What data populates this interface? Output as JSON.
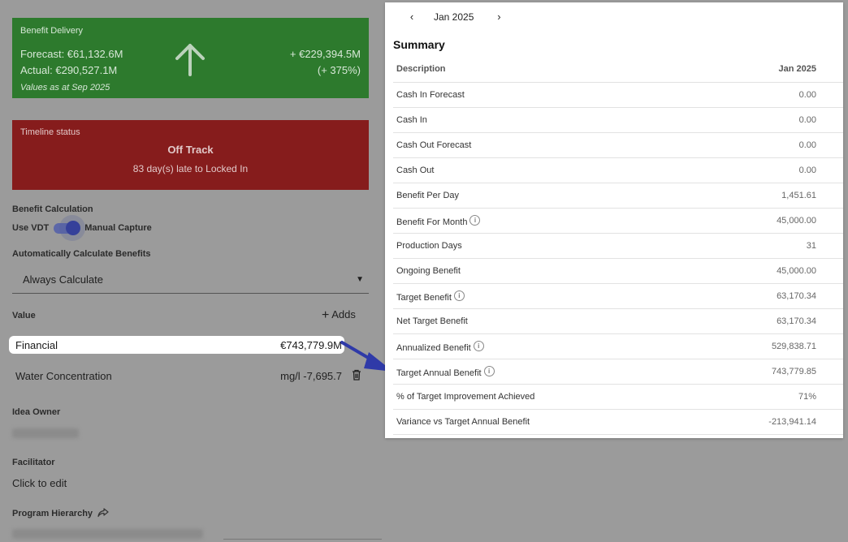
{
  "benefit_delivery": {
    "title": "Benefit Delivery",
    "forecast": "Forecast: €61,132.6M",
    "actual": "Actual: €290,527.1M",
    "as_of": "Values as at Sep 2025",
    "delta": "+ €229,394.5M",
    "delta_pct": "(+ 375%)",
    "trend_icon": "arrow-up-icon",
    "color": "#2d7a2d"
  },
  "timeline": {
    "title": "Timeline status",
    "status": "Off Track",
    "detail": "83 day(s) late to Locked In",
    "color": "#861c1c"
  },
  "calculation": {
    "label": "Benefit Calculation",
    "toggle_left": "Use VDT",
    "toggle_right": "Manual Capture",
    "toggle_on": true,
    "auto_label": "Automatically Calculate Benefits",
    "auto_value": "Always Calculate"
  },
  "value": {
    "label": "Value",
    "add_label": "Adds",
    "rows": [
      {
        "name": "Financial",
        "value": "€743,779.9M"
      },
      {
        "name": "Water Concentration",
        "value": "mg/l -7,695.7"
      }
    ]
  },
  "idea_owner": {
    "label": "Idea Owner"
  },
  "facilitator": {
    "label": "Facilitator",
    "value": "Click to edit"
  },
  "program_hierarchy": {
    "label": "Program Hierarchy"
  },
  "summary": {
    "month": "Jan 2025",
    "title": "Summary",
    "columns": [
      "Description",
      "Jan 2025"
    ],
    "rows": [
      {
        "desc": "Cash In Forecast",
        "value": "0.00",
        "info": false
      },
      {
        "desc": "Cash In",
        "value": "0.00",
        "info": false
      },
      {
        "desc": "Cash Out Forecast",
        "value": "0.00",
        "info": false
      },
      {
        "desc": "Cash Out",
        "value": "0.00",
        "info": false
      },
      {
        "desc": "Benefit Per Day",
        "value": "1,451.61",
        "info": false
      },
      {
        "desc": "Benefit For Month",
        "value": "45,000.00",
        "info": true
      },
      {
        "desc": "Production Days",
        "value": "31",
        "info": false
      },
      {
        "desc": "Ongoing Benefit",
        "value": "45,000.00",
        "info": false
      },
      {
        "desc": "Target Benefit",
        "value": "63,170.34",
        "info": true
      },
      {
        "desc": "Net Target Benefit",
        "value": "63,170.34",
        "info": false
      },
      {
        "desc": "Annualized Benefit",
        "value": "529,838.71",
        "info": true
      },
      {
        "desc": "Target Annual Benefit",
        "value": "743,779.85",
        "info": true
      },
      {
        "desc": "% of Target Improvement Achieved",
        "value": "71%",
        "info": false
      },
      {
        "desc": "Variance vs Target Annual Benefit",
        "value": "-213,941.14",
        "info": false
      }
    ]
  },
  "accent_arrow_color": "#2f3aa8"
}
